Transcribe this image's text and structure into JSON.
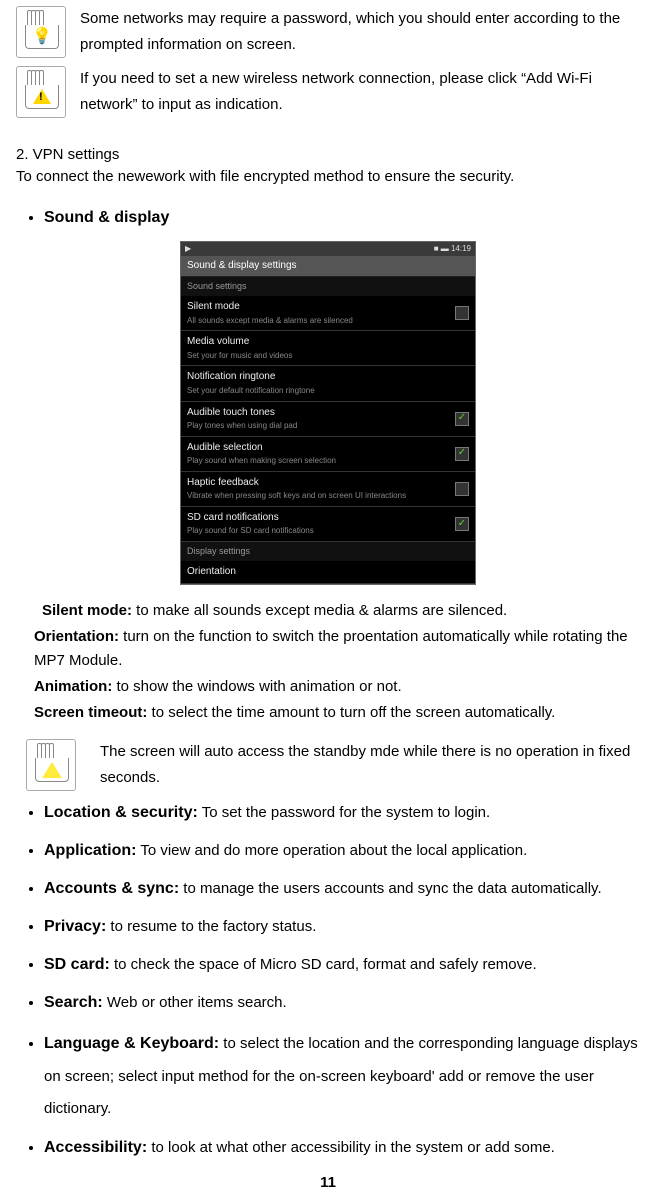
{
  "notes": {
    "password": "Some networks may require a password, which you should enter according to the prompted information on screen.",
    "addwifi": "If you need to set a new wireless network connection, please click “Add Wi-Fi network” to input as indication."
  },
  "vpn": {
    "heading": "2. VPN settings",
    "text": "To connect the newework with file encrypted method to ensure the security."
  },
  "sound_display": {
    "heading": "Sound & display",
    "screenshot": {
      "status_left": "▶",
      "status_right": "■ ▬ 14:19",
      "title": "Sound & display settings",
      "section1": "Sound settings",
      "rows": [
        {
          "label": "Silent mode",
          "sub": "All sounds except media & alarms are silenced",
          "check": false
        },
        {
          "label": "Media volume",
          "sub": "Set your for music and videos",
          "check": null
        },
        {
          "label": "Notification ringtone",
          "sub": "Set your default notification ringtone",
          "check": null
        },
        {
          "label": "Audible touch tones",
          "sub": "Play tones when using dial pad",
          "check": true
        },
        {
          "label": "Audible selection",
          "sub": "Play sound when making screen selection",
          "check": true
        },
        {
          "label": "Haptic feedback",
          "sub": "Vibrate when pressing soft keys and on screen UI interactions",
          "check": false
        },
        {
          "label": "SD card notifications",
          "sub": "Play sound for SD card notifications",
          "check": true
        }
      ],
      "section2": "Display settings",
      "row_last": {
        "label": "Orientation",
        "sub": ""
      }
    },
    "defs": [
      {
        "term": "Silent mode:",
        "desc": " to make all sounds except media & alarms are silenced."
      },
      {
        "term": "Orientation:",
        "desc": " turn on the function to switch the proentation automatically while rotating the MP7 Module."
      },
      {
        "term": "Animation:",
        "desc": " to show the windows with animation or not."
      },
      {
        "term": "Screen timeout:",
        "desc": " to select the time amount to turn off the screen automatically."
      }
    ],
    "standby_note": "The screen will auto access the standby mde while there is no operation in fixed seconds."
  },
  "bullets": [
    {
      "term": "Location & security:",
      "desc": " To set the password for the system to login."
    },
    {
      "term": "Application:",
      "desc": " To view and do more operation about the local application."
    },
    {
      "term": "Accounts & sync:",
      "desc": " to manage the users accounts and sync the data automatically."
    },
    {
      "term": "Privacy:",
      "desc": " to resume to the factory status."
    },
    {
      "term": "SD card:",
      "desc": " to check the space of Micro SD card, format and safely remove."
    },
    {
      "term": "Search:",
      "desc": " Web or other items search."
    },
    {
      "term": "Language & Keyboard:",
      "desc": " to select the location and the corresponding language displays on screen; select input method for the on-screen keyboard' add or remove the user dictionary."
    },
    {
      "term": "Accessibility:",
      "desc": " to look at what other accessibility in the system or add some."
    }
  ],
  "page_number": "11"
}
